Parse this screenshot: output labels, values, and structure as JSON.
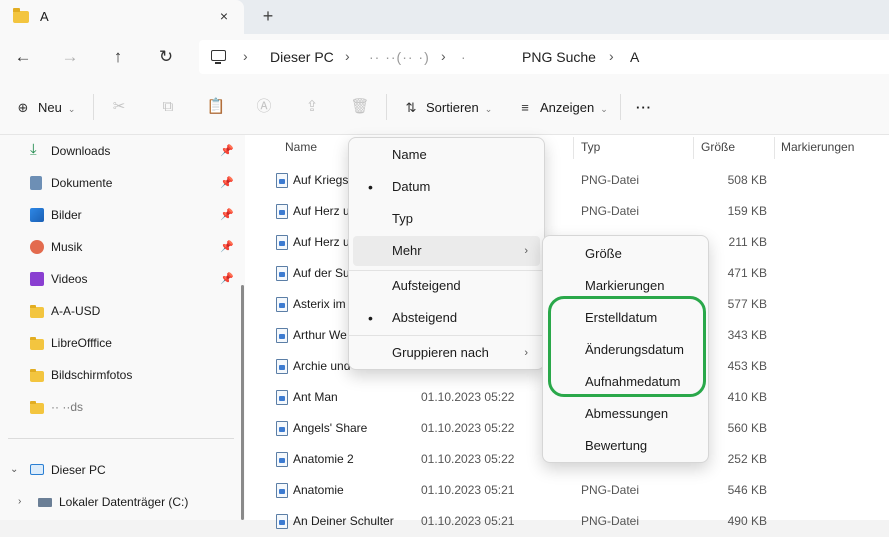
{
  "tab": {
    "title": "A",
    "close_icon": "×",
    "new_tab_icon": "+"
  },
  "address": {
    "crumbs": [
      "Dieser PC",
      "·· ··(·· ·)",
      "·",
      "PNG Suche",
      "A"
    ]
  },
  "commands": {
    "new_label": "Neu",
    "sort_label": "Sortieren",
    "view_label": "Anzeigen",
    "more_icon": "···"
  },
  "nav": {
    "quick": [
      {
        "label": "Downloads",
        "icon": "download-icon",
        "pinned": true
      },
      {
        "label": "Dokumente",
        "icon": "documents-icon",
        "pinned": true
      },
      {
        "label": "Bilder",
        "icon": "pictures-icon",
        "pinned": true
      },
      {
        "label": "Musik",
        "icon": "music-icon",
        "pinned": true
      },
      {
        "label": "Videos",
        "icon": "videos-icon",
        "pinned": true
      }
    ],
    "folders": [
      "A-A-USD",
      "LibreOfffice",
      "Bildschirmfotos",
      "·· ··ds"
    ],
    "this_pc": "Dieser PC",
    "local_disk": "Lokaler Datenträger (C:)",
    "pin_icon": "📌"
  },
  "columns": {
    "name": "Name",
    "type": "Typ",
    "size": "Größe",
    "tags": "Markierungen"
  },
  "files": [
    {
      "name": "Auf Kriegs",
      "date": "",
      "type": "PNG-Datei",
      "size": "508 KB"
    },
    {
      "name": "Auf Herz u",
      "date": "",
      "type": "PNG-Datei",
      "size": "159 KB"
    },
    {
      "name": "Auf Herz u",
      "date": "",
      "type": "",
      "size": "211 KB"
    },
    {
      "name": "Auf der Su",
      "date": "",
      "type": "",
      "size": "471 KB"
    },
    {
      "name": "Asterix im",
      "date": "",
      "type": "",
      "size": "577 KB"
    },
    {
      "name": "Arthur We",
      "date": "",
      "type": "",
      "size": "343 KB"
    },
    {
      "name": "Archie und",
      "date": "",
      "type": "",
      "size": "453 KB"
    },
    {
      "name": "Ant Man",
      "date": "01.10.2023 05:22",
      "type": "",
      "size": "410 KB"
    },
    {
      "name": "Angels' Share",
      "date": "01.10.2023 05:22",
      "type": "",
      "size": "560 KB"
    },
    {
      "name": "Anatomie 2",
      "date": "01.10.2023 05:22",
      "type": "",
      "size": "252 KB"
    },
    {
      "name": "Anatomie",
      "date": "01.10.2023 05:21",
      "type": "PNG-Datei",
      "size": "546 KB"
    },
    {
      "name": "An Deiner Schulter",
      "date": "01.10.2023 05:21",
      "type": "PNG-Datei",
      "size": "490 KB"
    }
  ],
  "sort_menu": {
    "items": [
      {
        "label": "Name",
        "bullet": ""
      },
      {
        "label": "Datum",
        "bullet": "•"
      },
      {
        "label": "Typ",
        "bullet": ""
      },
      {
        "label": "Mehr",
        "bullet": "",
        "arrow": "›"
      }
    ],
    "order": [
      {
        "label": "Aufsteigend",
        "bullet": ""
      },
      {
        "label": "Absteigend",
        "bullet": "•"
      }
    ],
    "group": {
      "label": "Gruppieren nach",
      "arrow": "›"
    }
  },
  "more_menu": {
    "items": [
      "Größe",
      "Markierungen",
      "Erstelldatum",
      "Änderungsdatum",
      "Aufnahmedatum",
      "Abmessungen",
      "Bewertung"
    ]
  },
  "colors": {
    "highlight": "#2aa84a",
    "folder": "#f3c53f",
    "accent": "#0067c0"
  }
}
